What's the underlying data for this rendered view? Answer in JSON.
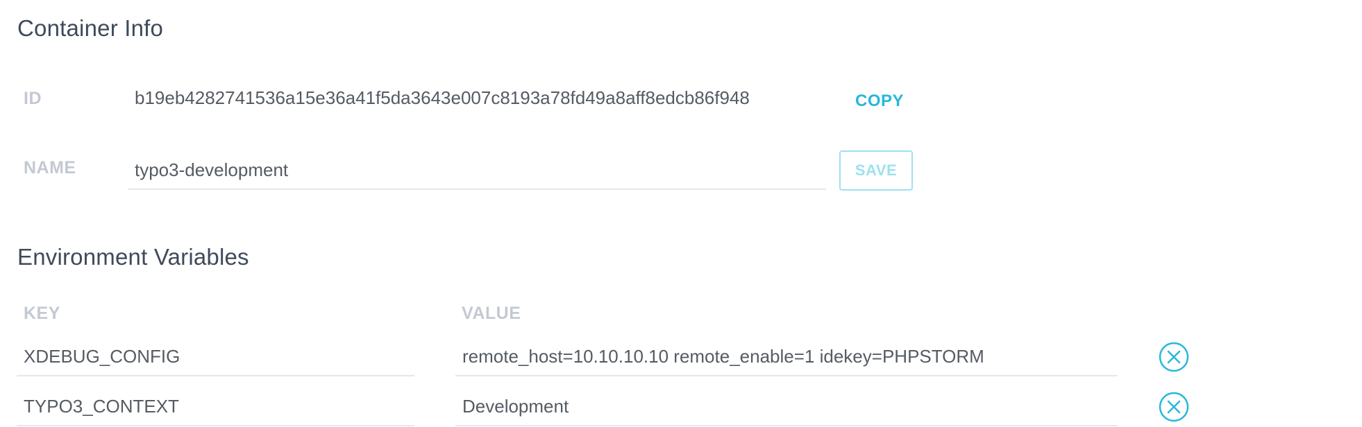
{
  "container_info": {
    "title": "Container Info",
    "id_label": "ID",
    "id_value": "b19eb4282741536a15e36a41f5da3643e007c8193a78fd49a8aff8edcb86f948",
    "copy_label": "COPY",
    "name_label": "NAME",
    "name_value": "typo3-development",
    "save_label": "SAVE"
  },
  "env": {
    "title": "Environment Variables",
    "key_header": "KEY",
    "value_header": "VALUE",
    "rows": [
      {
        "key": "XDEBUG_CONFIG",
        "value": "remote_host=10.10.10.10 remote_enable=1 idekey=PHPSTORM"
      },
      {
        "key": "TYPO3_CONTEXT",
        "value": "Development"
      }
    ]
  },
  "colors": {
    "accent": "#27b7dc",
    "accent_light": "#9ee0f0",
    "label": "#c3c9d3",
    "heading": "#3f4a5a",
    "text": "#555b63"
  },
  "icons": {
    "remove": "close-circle-icon"
  }
}
